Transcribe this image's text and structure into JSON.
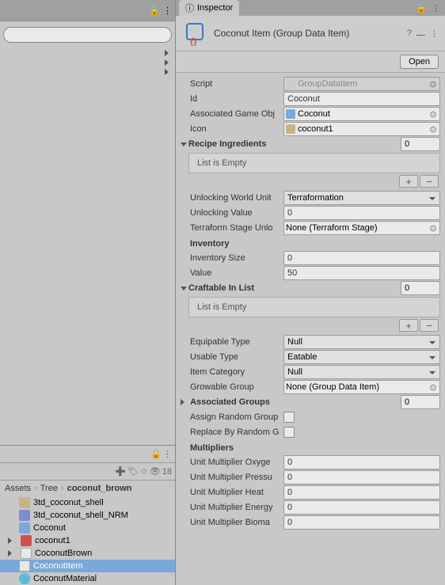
{
  "tabs": {
    "inspector": "Inspector"
  },
  "header": {
    "title": "Coconut Item (Group Data Item)",
    "open": "Open"
  },
  "project": {
    "visibility_count": "18",
    "breadcrumb": [
      "Assets",
      "Tree",
      "coconut_brown"
    ],
    "assets": [
      "3td_coconut_shell",
      "3td_coconut_shell_NRM",
      "Coconut",
      "coconut1",
      "CoconutBrown",
      "CoconutItem",
      "CoconutMaterial"
    ]
  },
  "fields": {
    "script_label": "Script",
    "script_value": "GroupDataItem",
    "id_label": "Id",
    "id_value": "Coconut",
    "assoc_go_label": "Associated Game Obj",
    "assoc_go_value": "Coconut",
    "icon_label": "Icon",
    "icon_value": "coconut1",
    "recipe_label": "Recipe Ingredients",
    "recipe_count": "0",
    "list_empty": "List is Empty",
    "uwu_label": "Unlocking World Unit",
    "uwu_value": "Terraformation",
    "uval_label": "Unlocking Value",
    "uval_value": "0",
    "tsu_label": "Terraform Stage Unlo",
    "tsu_value": "None (Terraform Stage)",
    "inventory_header": "Inventory",
    "invsize_label": "Inventory Size",
    "invsize_value": "0",
    "value_label": "Value",
    "value_value": "50",
    "craftable_label": "Craftable In List",
    "craftable_count": "0",
    "equip_label": "Equipable Type",
    "equip_value": "Null",
    "usable_label": "Usable Type",
    "usable_value": "Eatable",
    "itemcat_label": "Item Category",
    "itemcat_value": "Null",
    "growable_label": "Growable Group",
    "growable_value": "None (Group Data Item)",
    "assoc_groups_label": "Associated Groups",
    "assoc_groups_count": "0",
    "assign_rand_label": "Assign Random Group",
    "replace_rand_label": "Replace By Random G",
    "multipliers_header": "Multipliers",
    "mult_oxy_label": "Unit Multiplier Oxyge",
    "mult_oxy_value": "0",
    "mult_pres_label": "Unit Multiplier Pressu",
    "mult_pres_value": "0",
    "mult_heat_label": "Unit Multiplier Heat",
    "mult_heat_value": "0",
    "mult_energy_label": "Unit Multiplier Energy",
    "mult_energy_value": "0",
    "mult_biomas_label": "Unit Multiplier Bioma",
    "mult_biomas_value": "0"
  }
}
